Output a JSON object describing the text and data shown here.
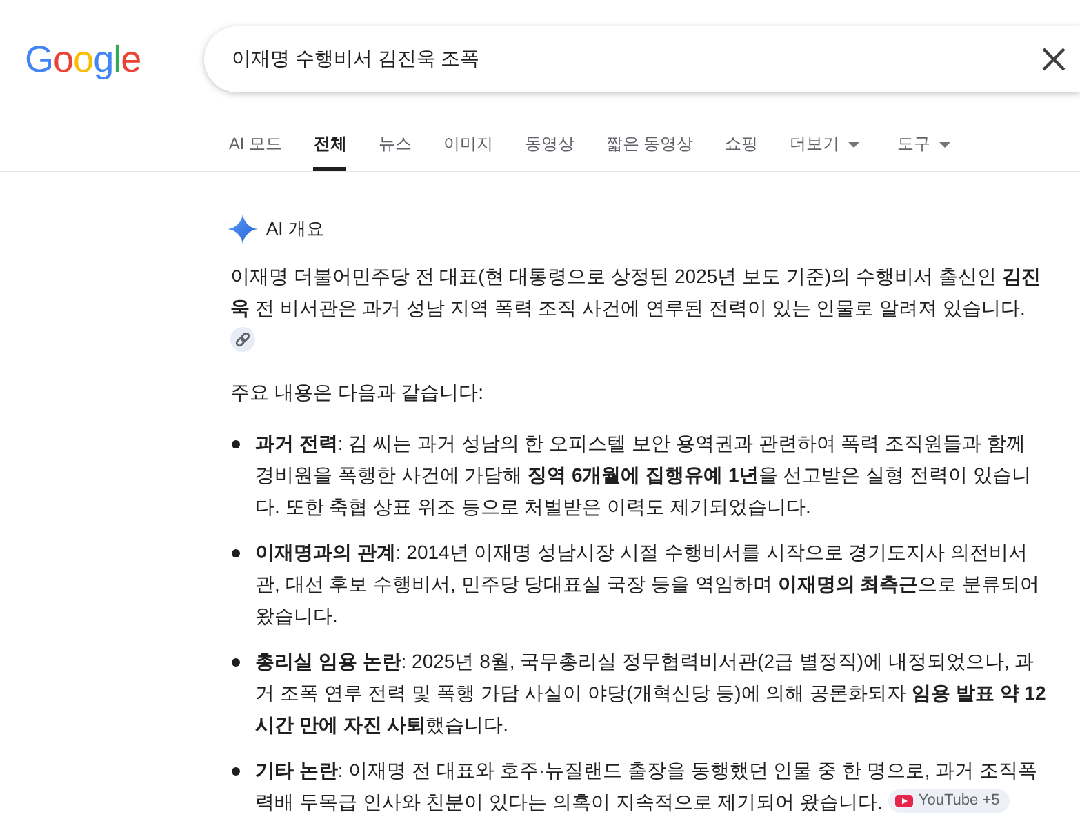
{
  "logo": {
    "text": "Google"
  },
  "search": {
    "value": "이재명 수행비서 김진욱 조폭"
  },
  "tabs": [
    {
      "label": "AI 모드",
      "selected": false,
      "menu": false
    },
    {
      "label": "전체",
      "selected": true,
      "menu": false
    },
    {
      "label": "뉴스",
      "selected": false,
      "menu": false
    },
    {
      "label": "이미지",
      "selected": false,
      "menu": false
    },
    {
      "label": "동영상",
      "selected": false,
      "menu": false
    },
    {
      "label": "짧은 동영상",
      "selected": false,
      "menu": false
    },
    {
      "label": "쇼핑",
      "selected": false,
      "menu": false
    },
    {
      "label": "더보기",
      "selected": false,
      "menu": true
    },
    {
      "label": "도구",
      "selected": false,
      "menu": true
    }
  ],
  "ai_overview": {
    "title": "AI 개요",
    "summary": "이재명 더불어민주당 전 대표(현 대통령으로 상정된 2025년 보도 기준)의 수행비서 출신인 **김진욱** 전 비서관은 과거 성남 지역 폭력 조직 사건에 연루된 전력이 있는 인물로 알려져 있습니다.",
    "intro": "주요 내용은 다음과 같습니다:",
    "points": [
      {
        "text": "**과거 전력**: 김 씨는 과거 성남의 한 오피스텔 보안 용역권과 관련하여 폭력 조직원들과 함께 경비원을 폭행한 사건에 가담해 **징역 6개월에 집행유예 1년**을 선고받은 실형 전력이 있습니다. 또한 축협 상표 위조 등으로 처벌받은 이력도 제기되었습니다."
      },
      {
        "text": "**이재명과의 관계**: 2014년 이재명 성남시장 시절 수행비서를 시작으로 경기도지사 의전비서관, 대선 후보 수행비서, 민주당 당대표실 국장 등을 역임하며 **이재명의 최측근**으로 분류되어 왔습니다."
      },
      {
        "text": "**총리실 임용 논란**: 2025년 8월, 국무총리실 정무협력비서관(2급 별정직)에 내정되었으나, 과거 조폭 연루 전력 및 폭행 가담 사실이 야당(개혁신당 등)에 의해 공론화되자 **임용 발표 약 12시간 만에 자진 사퇴**했습니다."
      },
      {
        "text": "**기타 논란**: 이재명 전 대표와 호주·뉴질랜드 출장을 동행했던 인물 중 한 명으로, 과거 조직폭력배 두목급 인사와 친분이 있다는 의혹이 지속적으로 제기되어 왔습니다.",
        "source": "YouTube +5"
      }
    ]
  }
}
